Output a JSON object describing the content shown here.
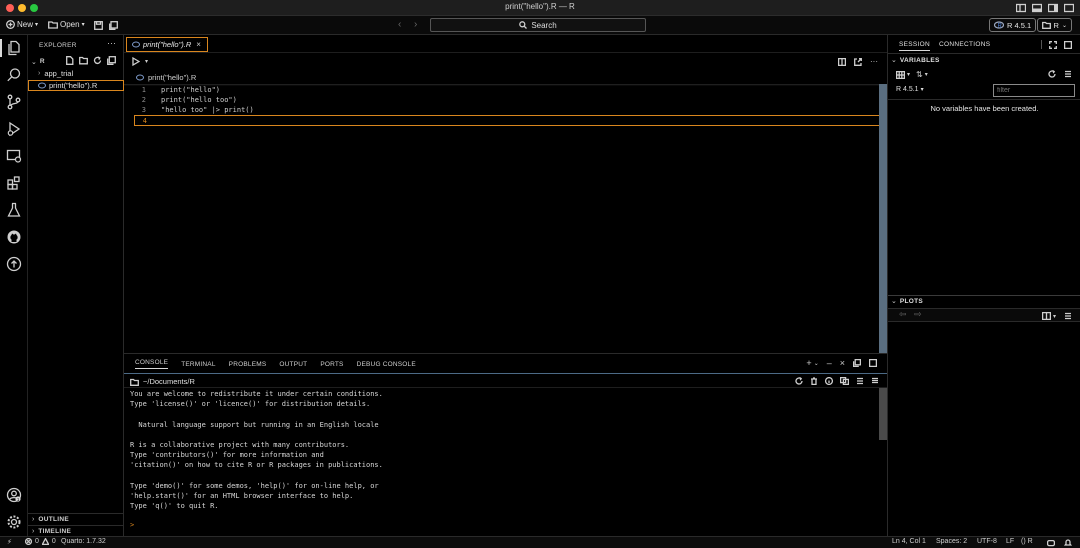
{
  "window": {
    "title": "print(\"hello\").R — R"
  },
  "toolbar": {
    "new_label": "New",
    "open_label": "Open",
    "search_label": "Search",
    "r_version_label": "R 4.5.1",
    "project_label": "R"
  },
  "explorer": {
    "header": "EXPLORER",
    "folder": "R",
    "items": [
      {
        "label": "app_trial",
        "type": "folder"
      },
      {
        "label": "print(\"hello\").R",
        "type": "file"
      }
    ],
    "outline_label": "OUTLINE",
    "timeline_label": "TIMELINE"
  },
  "editor": {
    "tab_label": "print(\"hello\").R",
    "breadcrumb": "print(\"hello\").R",
    "lines": [
      {
        "num": "1",
        "code": "print(\"hello\")"
      },
      {
        "num": "2",
        "code": "print(\"hello too\")"
      },
      {
        "num": "3",
        "code": "\"hello too\" |> print()"
      },
      {
        "num": "4",
        "code": ""
      }
    ]
  },
  "panel": {
    "tabs": [
      "CONSOLE",
      "TERMINAL",
      "PROBLEMS",
      "OUTPUT",
      "PORTS",
      "DEBUG CONSOLE"
    ],
    "path": "~/Documents/R",
    "console_lines": [
      "You are welcome to redistribute it under certain conditions.",
      "Type 'license()' or 'licence()' for distribution details.",
      "",
      "  Natural language support but running in an English locale",
      "",
      "R is a collaborative project with many contributors.",
      "Type 'contributors()' for more information and",
      "'citation()' on how to cite R or R packages in publications.",
      "",
      "Type 'demo()' for some demos, 'help()' for on-line help, or",
      "'help.start()' for an HTML browser interface to help.",
      "Type 'q()' to quit R."
    ],
    "prompt": ">"
  },
  "session": {
    "tab_session": "SESSION",
    "tab_connections": "CONNECTIONS",
    "variables_label": "VARIABLES",
    "r_selector": "R 4.5.1",
    "filter_placeholder": "filter",
    "empty_message": "No variables have been created.",
    "plots_label": "PLOTS"
  },
  "status": {
    "errors": "0",
    "warnings": "0",
    "quarto": "Quarto: 1.7.32",
    "position": "Ln 4, Col 1",
    "spaces": "Spaces: 2",
    "encoding": "UTF-8",
    "eol": "LF",
    "language": "R"
  },
  "colors": {
    "accent": "#d9861e",
    "traffic_red": "#ff5f57",
    "traffic_yellow": "#febc2e",
    "traffic_green": "#28c840"
  }
}
